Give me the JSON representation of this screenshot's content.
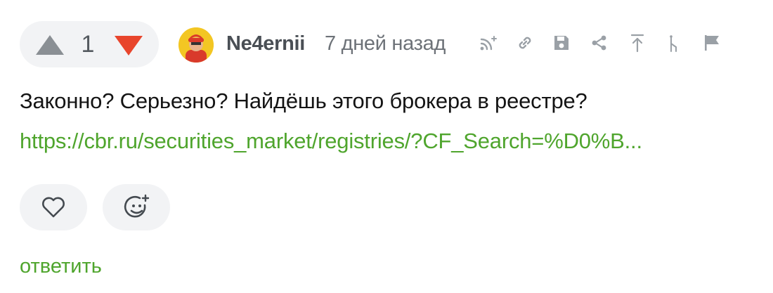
{
  "comment": {
    "votes": {
      "count": "1",
      "up_icon": "triangle-up-icon",
      "down_icon": "triangle-down-icon",
      "up_color": "#8a8f94",
      "down_color": "#e8452c"
    },
    "author": {
      "name": "Ne4ernii",
      "avatar_icon": "user-avatar"
    },
    "timestamp": "7 дней назад",
    "toolbar_icons": [
      "rss-icon",
      "link-icon",
      "save-icon",
      "share-icon",
      "arrow-up-icon",
      "branch-icon",
      "flag-icon"
    ],
    "text": "Законно? Серьезно? Найдёшь этого брокера в реестре?",
    "link_text": "https://cbr.ru/securities_market/registries/?CF_Search=%D0%B...",
    "reactions": {
      "like_icon": "heart-icon",
      "emoji_icon": "add-emoji-icon"
    },
    "reply_label": "ответить",
    "accent_color": "#4fa52d"
  }
}
